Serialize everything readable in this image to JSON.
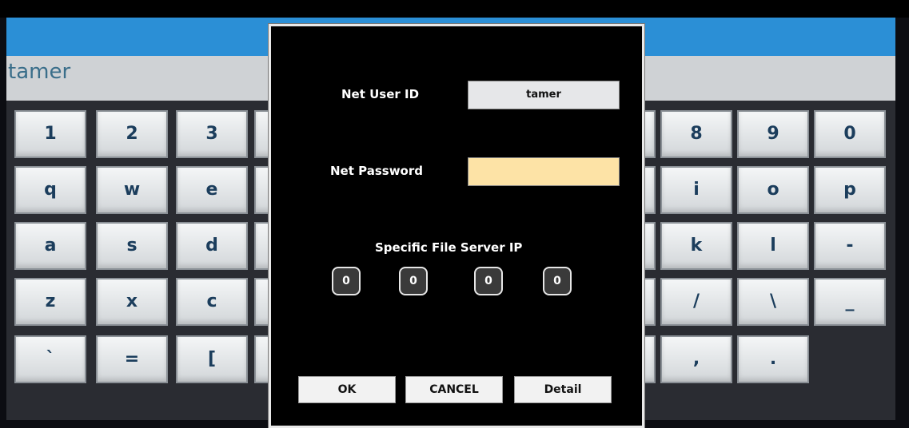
{
  "input": {
    "value": "tamer"
  },
  "keyboard": {
    "left": [
      [
        "1",
        "2",
        "3"
      ],
      [
        "q",
        "w",
        "e"
      ],
      [
        "a",
        "s",
        "d"
      ],
      [
        "z",
        "x",
        "c"
      ],
      [
        "`",
        "=",
        "["
      ]
    ],
    "right": [
      [
        "8",
        "9",
        "0"
      ],
      [
        "i",
        "o",
        "p"
      ],
      [
        "k",
        "l",
        "-"
      ],
      [
        "/",
        "\\",
        "_"
      ],
      [
        ",",
        "."
      ]
    ]
  },
  "dialog": {
    "user_id_label": "Net User ID",
    "user_id_value": "tamer",
    "password_label": "Net Password",
    "password_value": "",
    "server_ip_label": "Specific File Server IP",
    "ip": [
      "0",
      "0",
      "0",
      "0"
    ],
    "ok_label": "OK",
    "cancel_label": "CANCEL",
    "detail_label": "Detail"
  },
  "colors": {
    "blue_bar": "#2b8fd6",
    "password_field": "#fde3a6",
    "user_field": "#e6e7e9"
  }
}
